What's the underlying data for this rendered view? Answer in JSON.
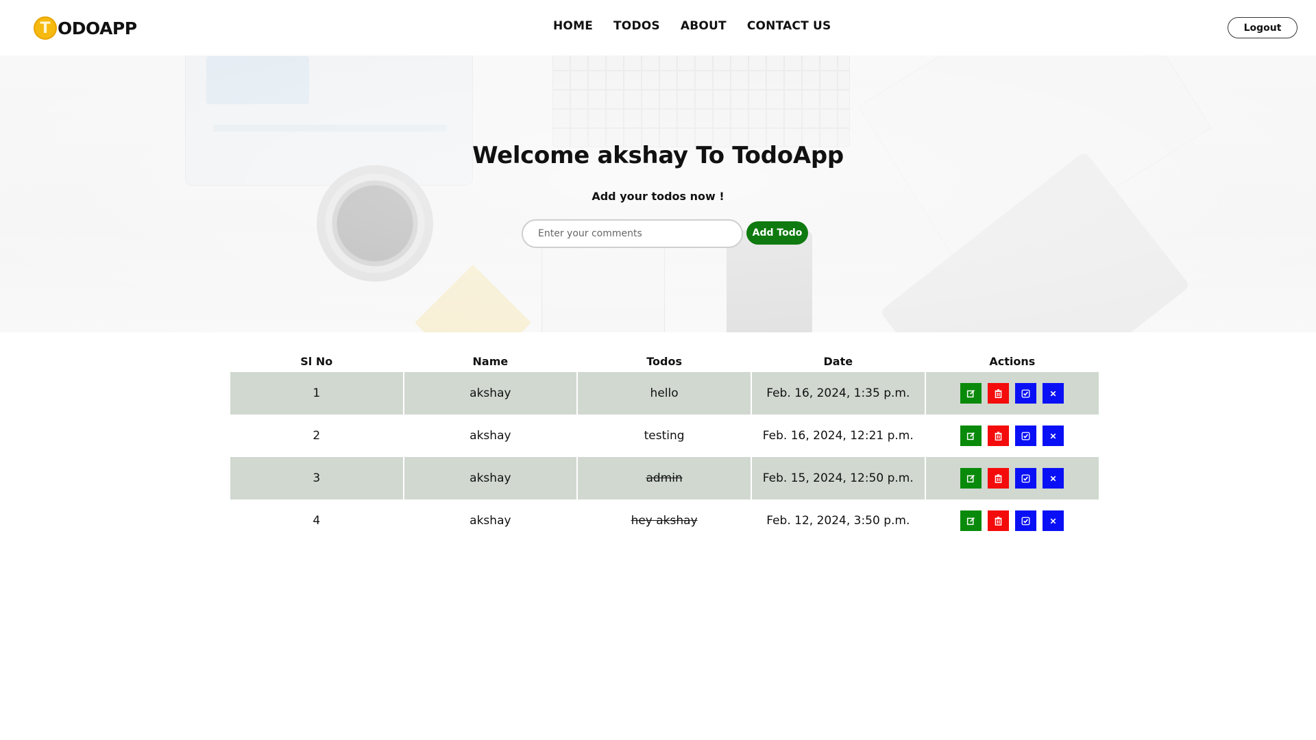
{
  "header": {
    "logo_letter": "T",
    "logo_text": "ODOAPP",
    "nav": [
      {
        "label": "HOME"
      },
      {
        "label": "TODOS"
      },
      {
        "label": "ABOUT"
      },
      {
        "label": "CONTACT US"
      }
    ],
    "logout_label": "Logout"
  },
  "hero": {
    "title": "Welcome akshay To TodoApp",
    "subtitle": "Add your todos now !",
    "input_placeholder": "Enter your comments",
    "input_value": "",
    "add_button_label": "Add Todo"
  },
  "table": {
    "headers": [
      "Sl No",
      "Name",
      "Todos",
      "Date",
      "Actions"
    ],
    "rows": [
      {
        "sl": "1",
        "name": "akshay",
        "todo": "hello",
        "date": "Feb. 16, 2024, 1:35 p.m.",
        "completed": false
      },
      {
        "sl": "2",
        "name": "akshay",
        "todo": "testing",
        "date": "Feb. 16, 2024, 12:21 p.m.",
        "completed": false
      },
      {
        "sl": "3",
        "name": "akshay",
        "todo": "admin",
        "date": "Feb. 15, 2024, 12:50 p.m.",
        "completed": true
      },
      {
        "sl": "4",
        "name": "akshay",
        "todo": "hey akshay",
        "date": "Feb. 12, 2024, 3:50 p.m.",
        "completed": true
      }
    ],
    "action_icons": [
      "edit-icon",
      "trash-icon",
      "check-icon",
      "close-icon"
    ]
  },
  "colors": {
    "accent_green": "#0f7a0f",
    "delete_red": "#f40b0b",
    "action_blue": "#0a10f5",
    "row_shade": "#d0d8d0",
    "logo_yellow": "#f6b90f"
  }
}
